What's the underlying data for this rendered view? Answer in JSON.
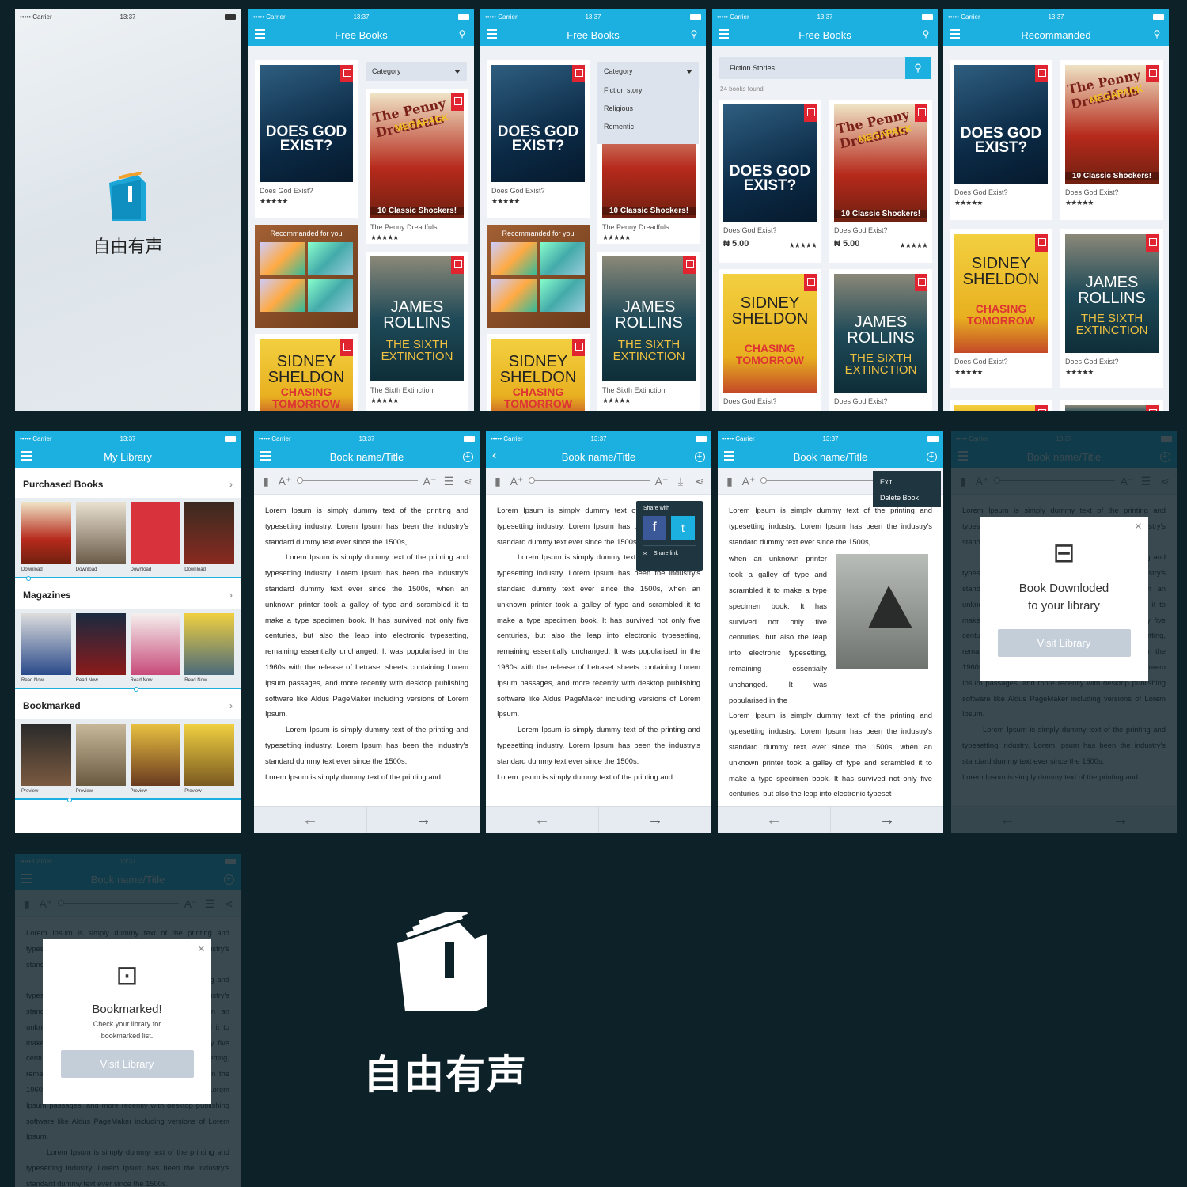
{
  "status": {
    "carrier": "••••• Carrier",
    "time": "13:37"
  },
  "brand": {
    "name": "自由有声",
    "color": "#1cb0e0"
  },
  "screen_free": {
    "title": "Free Books",
    "category": "Category",
    "recommended": "Recommanded for you",
    "books": [
      {
        "title": "Does God Exist?",
        "stars": "★★★★★"
      },
      {
        "title": "The Penny Dreadfuls....",
        "stars": "★★★★★"
      },
      {
        "title": "The Sixth Extinction",
        "stars": "★★★★★"
      }
    ]
  },
  "dropdown": {
    "label": "Category",
    "options": [
      "Fiction story",
      "Religious",
      "Romentic"
    ]
  },
  "search_screen": {
    "title": "Free Books",
    "query": "Fiction Stories",
    "found": "24 books found",
    "price1": "₦ 5.00",
    "price2": "₦ 5.00",
    "books": [
      "Does God Exist?",
      "Does God Exist?",
      "Does God Exist?",
      "Does God Exist?"
    ]
  },
  "recommanded": {
    "title": "Recommanded",
    "books": [
      "Does God Exist?",
      "Does God Exist?",
      "Does God Exist?",
      "Does God Exist?"
    ]
  },
  "covers": {
    "god": "DOES GOD EXIST?",
    "penny_a": "The Penny Dreadfuls",
    "penny_b": "MEGAPACK",
    "penny_c": "10 Classic Shockers!",
    "jr_a": "JAMES ROLLINS",
    "jr_b": "THE SIXTH EXTINCTION",
    "ss_a": "SIDNEY SHELDON",
    "ss_b": "CHASING TOMORROW"
  },
  "library": {
    "title": "My Library",
    "sections": [
      {
        "name": "Purchased Books",
        "label": "Download"
      },
      {
        "name": "Magazines",
        "label": "Read Now"
      },
      {
        "name": "Bookmarked",
        "label": "Preview"
      }
    ]
  },
  "reader": {
    "title": "Book name/Title",
    "p1": "Lorem Ipsum is simply dummy text of the printing and typesetting industry. Lorem Ipsum has been the industry's standard dummy text ever since the 1500s,",
    "p2": "Lorem Ipsum is simply dummy text of the printing and typesetting industry. Lorem Ipsum has been the industry's standard dummy text ever since the 1500s, when an unknown printer took a galley of type and scrambled it to make a type specimen book. It has survived not only five centuries, but also the leap into electronic typesetting, remaining essentially unchanged. It was popularised in the 1960s with the release of Letraset sheets containing Lorem Ipsum passages, and more recently with desktop publishing software like Aldus PageMaker including versions of Lorem Ipsum.",
    "p3": "Lorem Ipsum is simply dummy text of the printing and typesetting industry. Lorem Ipsum has been the industry's standard dummy text ever since the 1500s.",
    "p4": "Lorem Ipsum is simply dummy text of the printing and",
    "p5": "when an unknown printer took a galley of type and scrambled it to make a type specimen book. It has survived not only five centuries, but also the leap into electronic typesetting, remaining essentially unchanged. It was popularised in the",
    "p6": "Lorem Ipsum is simply dummy text of the printing and typesetting industry. Lorem Ipsum has been the industry's standard dummy text ever since the 1500s, when an unknown printer took a galley of type and scrambled it to make a type specimen book. It has survived not only five centuries, but also the leap into electronic typeset-",
    "share_with": "Share with",
    "share_link": "Share link",
    "menu": [
      "Exit",
      "Delete Book"
    ]
  },
  "dialogs": {
    "downloaded": {
      "line1": "Book Downloded",
      "line2": "to your library",
      "button": "Visit Library"
    },
    "bookmarked": {
      "title": "Bookmarked!",
      "line1": "Check your library for",
      "line2": "bookmarked list.",
      "button": "Visit Library"
    }
  }
}
